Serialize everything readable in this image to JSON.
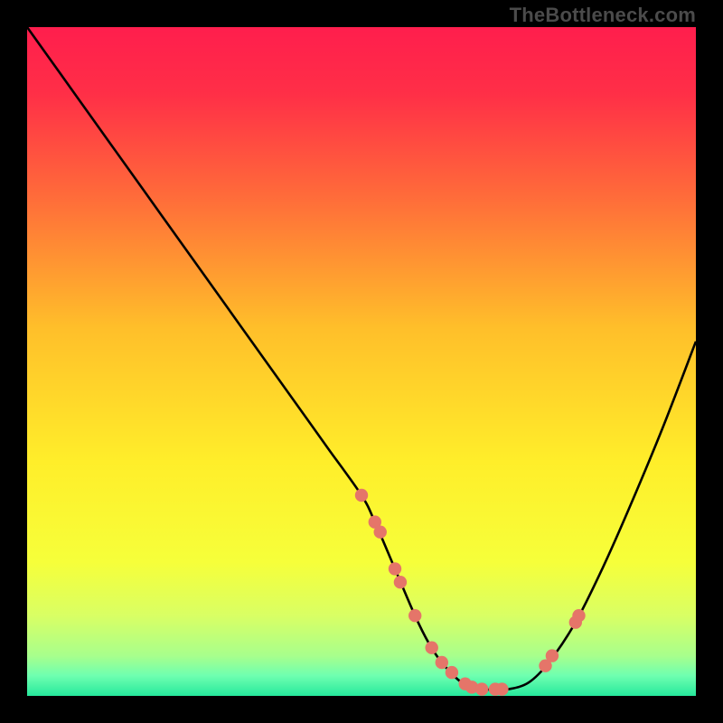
{
  "attribution": "TheBottleneck.com",
  "colors": {
    "frame": "#000000",
    "gradient_stops": [
      {
        "offset": 0.0,
        "color": "#ff1e4d"
      },
      {
        "offset": 0.1,
        "color": "#ff2f47"
      },
      {
        "offset": 0.25,
        "color": "#ff6a3a"
      },
      {
        "offset": 0.45,
        "color": "#ffbf2a"
      },
      {
        "offset": 0.65,
        "color": "#ffee2a"
      },
      {
        "offset": 0.8,
        "color": "#f6ff3a"
      },
      {
        "offset": 0.88,
        "color": "#d9ff64"
      },
      {
        "offset": 0.94,
        "color": "#a8ff8c"
      },
      {
        "offset": 0.97,
        "color": "#6effb0"
      },
      {
        "offset": 1.0,
        "color": "#26e89c"
      }
    ],
    "curve": "#000000",
    "dot": "#e57569"
  },
  "chart_data": {
    "type": "line",
    "title": "",
    "xlabel": "",
    "ylabel": "",
    "xlim": [
      0,
      100
    ],
    "ylim": [
      0,
      100
    ],
    "grid": false,
    "series": [
      {
        "name": "bottleneck-curve",
        "x": [
          0,
          5,
          10,
          15,
          20,
          25,
          30,
          35,
          40,
          45,
          50,
          52,
          55,
          58,
          60,
          62,
          65,
          68,
          70,
          72,
          75,
          78,
          82,
          86,
          90,
          95,
          100
        ],
        "y": [
          100,
          93,
          86,
          79,
          72,
          65,
          58,
          51,
          44,
          37,
          30,
          26,
          19,
          12,
          8,
          5,
          2,
          1,
          1,
          1,
          2,
          5,
          11,
          19,
          28,
          40,
          53
        ]
      }
    ],
    "dots": {
      "name": "highlight-points",
      "x": [
        50.0,
        52.0,
        52.8,
        55.0,
        55.8,
        58.0,
        60.5,
        62.0,
        63.5,
        65.5,
        66.5,
        68.0,
        70.0,
        71.0,
        77.5,
        78.5,
        82.0,
        82.5
      ],
      "y": [
        30.0,
        26.0,
        24.5,
        19.0,
        17.0,
        12.0,
        7.2,
        5.0,
        3.5,
        1.8,
        1.3,
        1.0,
        1.0,
        1.0,
        4.5,
        6.0,
        11.0,
        12.0
      ]
    }
  }
}
